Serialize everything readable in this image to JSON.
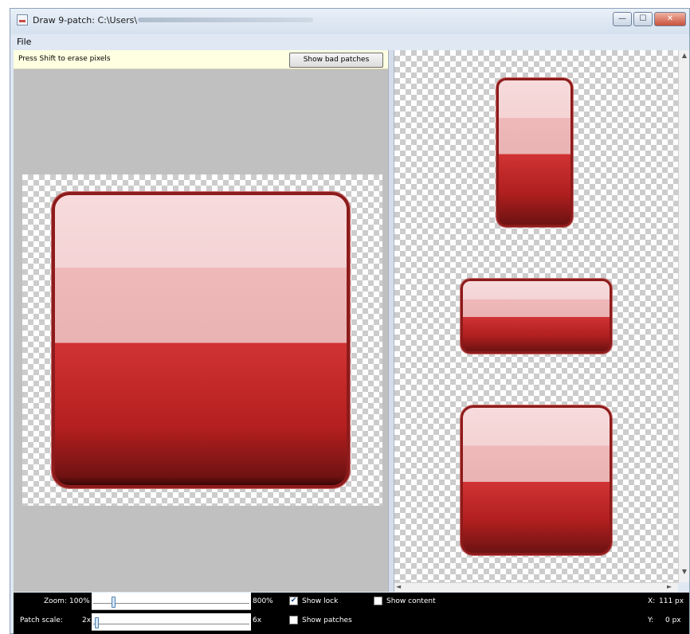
{
  "window": {
    "title": "Draw 9-patch: C:\\Users\\",
    "controls": {
      "minimize": "—",
      "maximize": "☐",
      "close": "✕"
    }
  },
  "menubar": {
    "file": "File"
  },
  "editor": {
    "hint": "Press Shift to erase pixels",
    "bad_patches_button": "Show bad patches"
  },
  "status": {
    "zoom_label": "Zoom:",
    "zoom_min": "100%",
    "zoom_max": "800%",
    "zoom_level": 0.11,
    "patch_scale_label": "Patch scale:",
    "patch_scale_min": "2x",
    "patch_scale_max": "6x",
    "patch_scale_level": 0.0,
    "show_lock": {
      "label": "Show lock",
      "checked": true
    },
    "show_content": {
      "label": "Show content",
      "checked": false
    },
    "show_patches": {
      "label": "Show patches",
      "checked": false
    },
    "x_label": "X:",
    "x_value": "111 px",
    "y_label": "Y:",
    "y_value": "0 px"
  },
  "colors": {
    "button_border": "#8d1b1b",
    "button_top": "#f7dbdc",
    "button_mid": "#efb8b9",
    "button_red": "#d13333",
    "button_dark": "#6d1212"
  }
}
